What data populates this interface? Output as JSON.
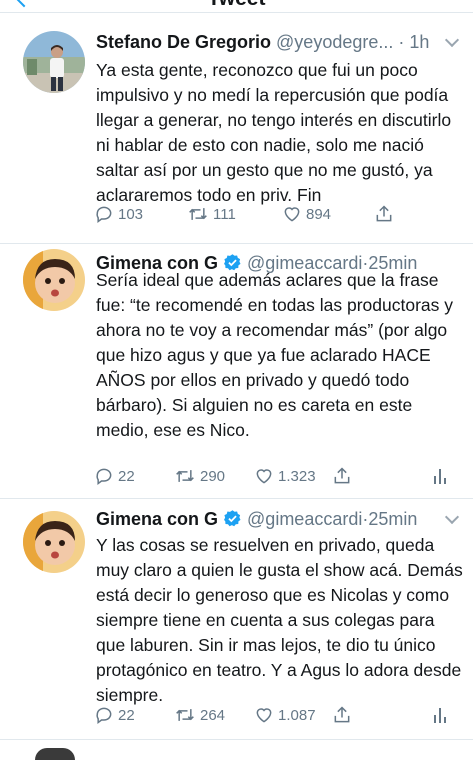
{
  "header": {
    "title": "Tweet"
  },
  "tweets": [
    {
      "name": "Stefano De Gregorio",
      "verified": false,
      "handle": "@yeyodegre...",
      "separator": "·",
      "time": "1h",
      "text": "Ya esta gente, reconozco que fui un poco impulsivo y no medí la repercusión que podía llegar a generar, no tengo interés en discutirlo ni hablar de esto con nadie, solo me nació saltar así por un gesto que no me gustó, ya aclararemos todo en priv. Fin",
      "replies": "103",
      "retweets": "111",
      "likes": "894",
      "show_analytics": false
    },
    {
      "name": "Gimena con G",
      "verified": true,
      "handle": "@gimeaccardi",
      "separator": "·",
      "time": "25min",
      "text": "Sería ideal que además aclares que la frase fue: “te recomendé en todas las productoras y ahora no te voy a recomendar más” (por algo que hizo agus y que ya fue aclarado HACE AÑOS por ellos en privado y quedó todo bárbaro). Si alguien no es careta en este medio, ese es Nico.",
      "replies": "22",
      "retweets": "290",
      "likes": "1.323",
      "show_analytics": true
    },
    {
      "name": "Gimena con G",
      "verified": true,
      "handle": "@gimeaccardi",
      "separator": "·",
      "time": "25min",
      "text": "Y las cosas se resuelven en privado, queda muy claro a quien le gusta el show acá. Demás está decir lo generoso que es Nicolas y como siempre tiene en cuenta a sus colegas para que laburen. Sin ir mas lejos, te dio tu único protagónico en teatro. Y a Agus lo adora desde siempre.",
      "replies": "22",
      "retweets": "264",
      "likes": "1.087",
      "show_analytics": true
    }
  ],
  "icons": {
    "reply": "reply-icon",
    "retweet": "retweet-icon",
    "like": "heart-icon",
    "share": "share-icon",
    "analytics": "analytics-icon",
    "verified": "verified-badge-icon",
    "caret": "chevron-down-icon"
  },
  "colors": {
    "accent": "#1da1f2",
    "secondary_text": "#657786",
    "divider": "#e1e8ed"
  }
}
